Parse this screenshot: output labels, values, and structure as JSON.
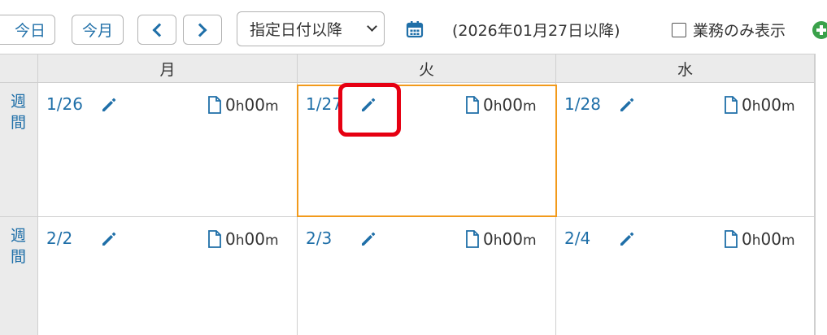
{
  "toolbar": {
    "today_label": "今日",
    "month_label": "今月",
    "prev_icon": "chevron-left-icon",
    "next_icon": "chevron-right-icon",
    "filter_selected": "指定日付以降",
    "calendar_icon": "calendar-icon",
    "date_note": "(2026年01月27日以降)",
    "business_only_label": "業務のみ表示",
    "business_only_checked": false,
    "add_icon": "plus-circle-icon"
  },
  "colors": {
    "link": "#1f6fa8",
    "selected_border": "#f29a1b",
    "highlight_border": "#e60012",
    "add_icon": "#3aa14a"
  },
  "calendar": {
    "days_of_week": [
      "月",
      "火",
      "水"
    ],
    "week_label": [
      "週",
      "間"
    ],
    "weeks": [
      {
        "days": [
          {
            "date": "1/26",
            "duration_h": "0",
            "duration_m": "00"
          },
          {
            "date": "1/27",
            "duration_h": "0",
            "duration_m": "00"
          },
          {
            "date": "1/28",
            "duration_h": "0",
            "duration_m": "00"
          }
        ]
      },
      {
        "days": [
          {
            "date": "2/2",
            "duration_h": "0",
            "duration_m": "00"
          },
          {
            "date": "2/3",
            "duration_h": "0",
            "duration_m": "00"
          },
          {
            "date": "2/4",
            "duration_h": "0",
            "duration_m": "00"
          }
        ]
      }
    ],
    "hour_unit": "h",
    "minute_unit": "m"
  }
}
